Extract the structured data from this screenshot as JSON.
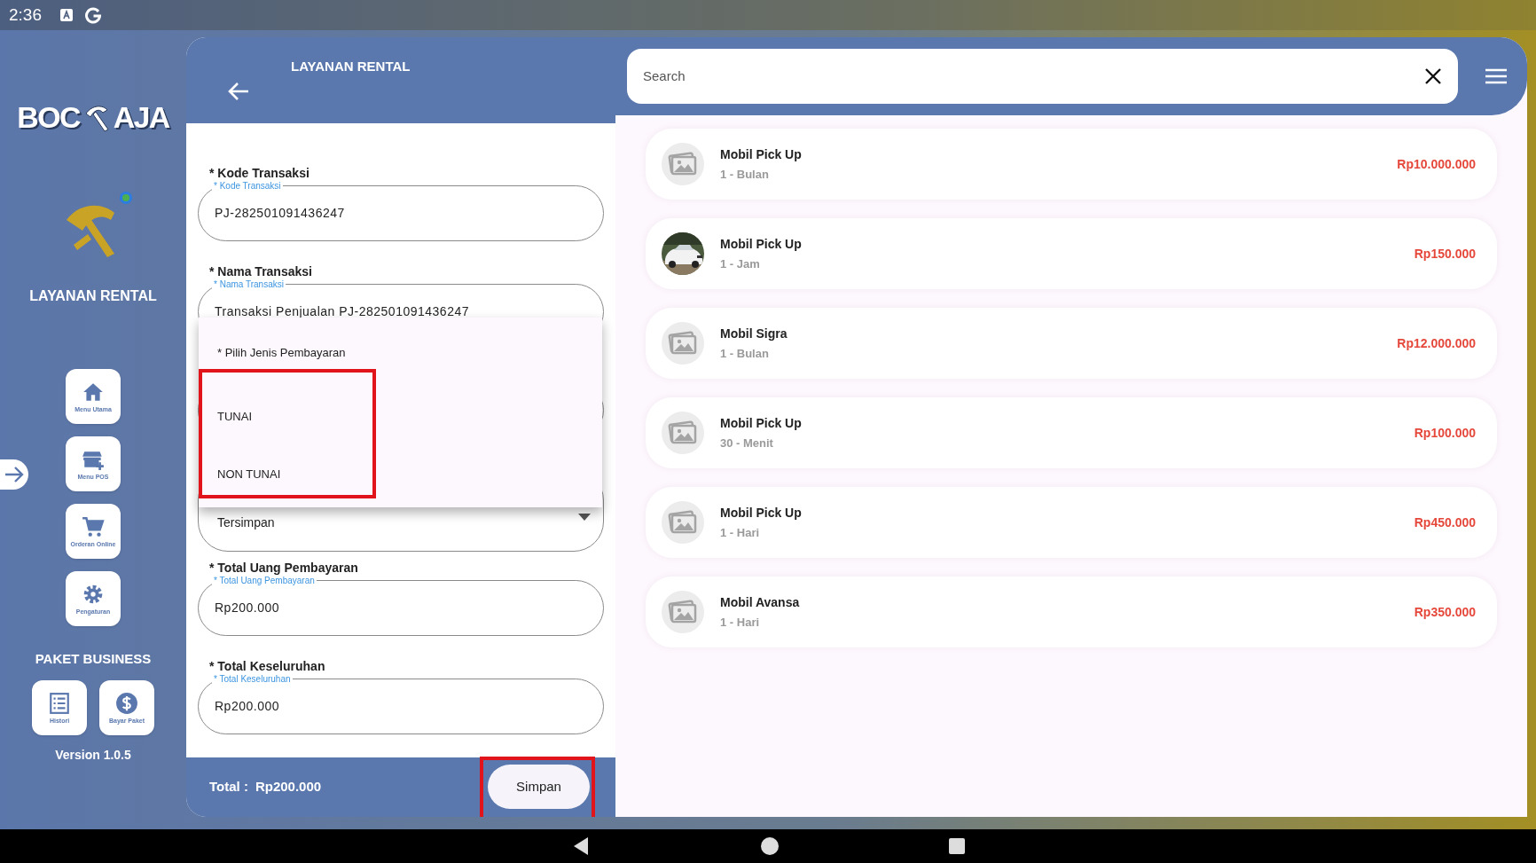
{
  "status_bar": {
    "time": "2:36"
  },
  "sidebar": {
    "logo": [
      "BOC",
      "AJA"
    ],
    "app_title": "LAYANAN RENTAL",
    "notification_dot": true,
    "menu": [
      {
        "label": "Menu Utama",
        "kind": "home"
      },
      {
        "label": "Menu POS",
        "kind": "store"
      },
      {
        "label": "Orderan Online",
        "kind": "cart"
      },
      {
        "label": "Pengaturan",
        "kind": "gear"
      }
    ],
    "package_title": "PAKET BUSINESS",
    "package_menu": [
      {
        "label": "Histori",
        "kind": "list"
      },
      {
        "label": "Bayar Paket",
        "kind": "dollar"
      }
    ],
    "version": "Version 1.0.5"
  },
  "form": {
    "title": "LAYANAN RENTAL",
    "fields": [
      {
        "label": "* Kode Transaksi",
        "floating_label": "* Kode Transaksi",
        "value": "PJ-282501091436247",
        "kind": "text"
      },
      {
        "label": "* Nama Transaksi",
        "floating_label": "* Nama Transaksi",
        "value": "Transaksi Penjualan PJ-282501091436247",
        "kind": "text"
      },
      {
        "kind": "hidden"
      },
      {
        "value": "Tersimpan",
        "kind": "select"
      },
      {
        "label": "* Total Uang Pembayaran",
        "floating_label": "* Total Uang Pembayaran",
        "value": "Rp200.000",
        "kind": "text"
      },
      {
        "label": "* Total Keseluruhan",
        "floating_label": "* Total Keseluruhan",
        "value": "Rp200.000",
        "kind": "text"
      }
    ],
    "dropdown": {
      "header": "* Pilih Jenis Pembayaran",
      "options": [
        "TUNAI",
        "NON TUNAI"
      ],
      "options_highlighted": true
    },
    "total_label": "Total :",
    "total_value": "Rp200.000",
    "save_button": {
      "label": "Simpan",
      "highlighted": true
    }
  },
  "catalog": {
    "search": {
      "placeholder": "Search"
    },
    "items": [
      {
        "name": "Mobil Pick Up",
        "duration": "1 - Bulan",
        "price": "Rp10.000.000",
        "kind": "placeholder"
      },
      {
        "name": "Mobil Pick Up",
        "duration": "1 - Jam",
        "price": "Rp150.000"
      },
      {
        "name": "Mobil Sigra",
        "duration": "1 - Bulan",
        "price": "Rp12.000.000",
        "kind": "placeholder"
      },
      {
        "name": "Mobil Pick Up",
        "duration": "30 - Menit",
        "price": "Rp100.000",
        "kind": "placeholder"
      },
      {
        "name": "Mobil Pick Up",
        "duration": "1 - Hari",
        "price": "Rp450.000",
        "kind": "placeholder"
      },
      {
        "name": "Mobil Avansa",
        "duration": "1 - Hari",
        "price": "Rp350.000",
        "kind": "placeholder"
      }
    ]
  }
}
